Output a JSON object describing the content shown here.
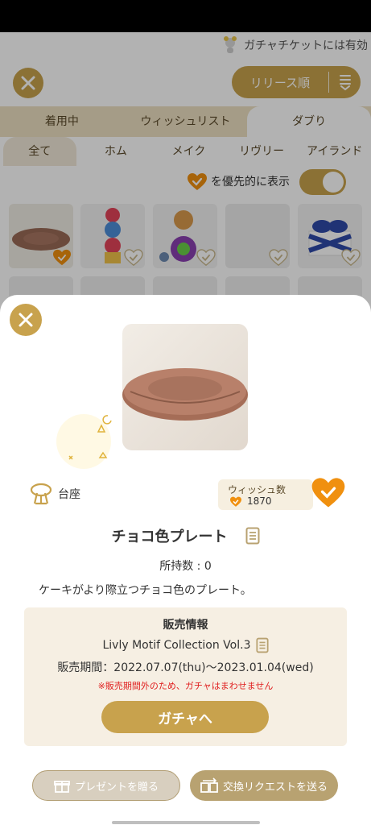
{
  "ticker": {
    "text": "ガチャチケットには有効"
  },
  "background": {
    "sort_label": "リリース順",
    "tabs": [
      {
        "label": "着用中",
        "active": false
      },
      {
        "label": "ウィッシュリスト",
        "active": false
      },
      {
        "label": "ダブり",
        "active": true
      }
    ],
    "subtabs": [
      {
        "label": "全て",
        "active": true
      },
      {
        "label": "ホム",
        "active": false
      },
      {
        "label": "メイク",
        "active": false
      },
      {
        "label": "リヴリー",
        "active": false
      },
      {
        "label": "アイランド",
        "active": false
      }
    ],
    "pref_label": "を優先的に表示",
    "pref_toggle_on": true
  },
  "modal": {
    "category": "台座",
    "wish_label": "ウィッシュ数",
    "wish_count": "1870",
    "wished": true,
    "item_name": "チョコ色プレート",
    "owned": "所持数 : 0",
    "description": "ケーキがより際立つチョコ色のプレート。",
    "sale": {
      "header": "販売情報",
      "collection": "Livly Motif Collection Vol.3",
      "period": "販売期間：2022.07.07(thu)〜2023.01.04(wed)",
      "warning": "※販売期間外のため、ガチャはまわせません",
      "gacha_button": "ガチャへ"
    },
    "present_button": "プレゼントを贈る",
    "exchange_button": "交換リクエストを送る"
  },
  "colors": {
    "accent": "#c8a24d",
    "heart": "#f0900f",
    "warning": "#e02020"
  }
}
